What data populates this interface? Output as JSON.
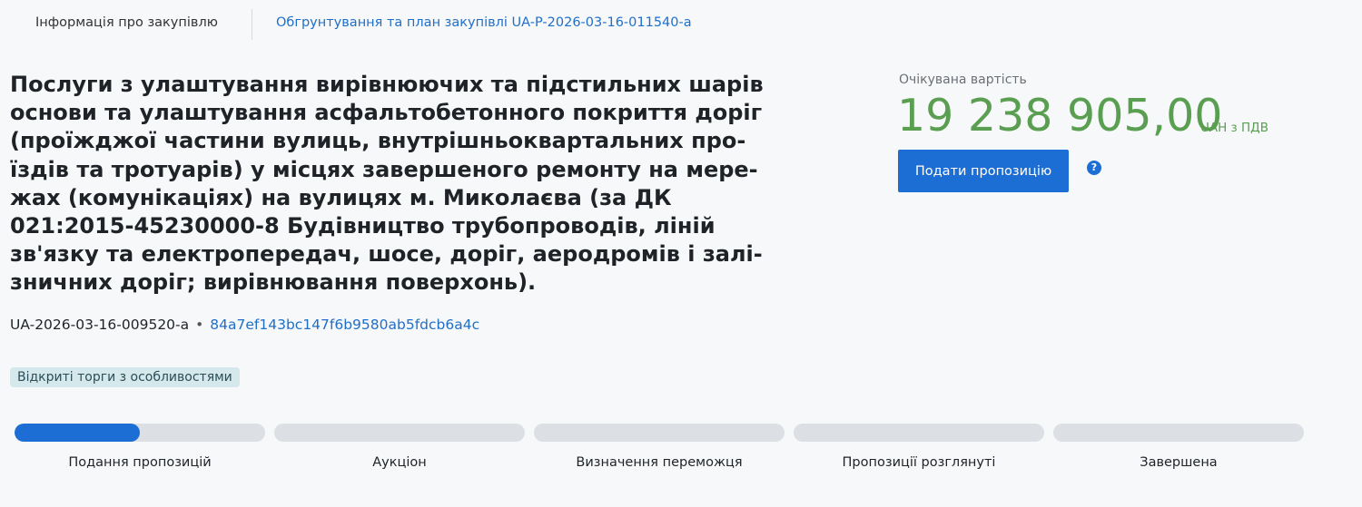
{
  "tabs": {
    "info_label": "Інформація про закупівлю",
    "plan_label": "Обгрунтування та план закупівлі UA-P-2026-03-16-011540-a"
  },
  "tender": {
    "title": "Послуги з улаштування вирівнюючих та підстильних шарів\nоснови та улаштування асфальтобетонного покриття доріг\n(проїжджої частини вулиць, внутрішньоквартальних про-\nїздів та тротуарів) у місцях завершеного ремонту на мере-\nжах (комунікаціях) на вулицях м. Миколаєва (за ДК\n021:2015-45230000-8    Будівництво трубопроводів, ліній\nзв'язку та електропередач, шосе, доріг, аеродромів і залі-\nзничних доріг; вирівнювання поверхонь).",
    "id": "UA-2026-03-16-009520-a",
    "separator": "•",
    "hash": "84a7ef143bc147f6b9580ab5fdcb6a4c",
    "procedure_badge": "Відкриті торги з особливостями"
  },
  "price": {
    "label": "Очікувана вартість",
    "amount": "19 238 905,00",
    "unit": "UAH з ПДВ",
    "color": "#5a9e51"
  },
  "actions": {
    "submit_label": "Подати пропозицію",
    "help_glyph": "?",
    "help_icon": "question-circle-icon"
  },
  "stages": [
    {
      "label": "Подання пропозицій",
      "progress": 0.5
    },
    {
      "label": "Аукціон",
      "progress": 0
    },
    {
      "label": "Визначення переможця",
      "progress": 0
    },
    {
      "label": "Пропозиції розглянуті",
      "progress": 0
    },
    {
      "label": "Завершена",
      "progress": 0
    }
  ],
  "colors": {
    "accent": "#1d6ed4",
    "link": "#1f6fc9",
    "badge_bg": "#d5e8ec",
    "track": "#dcdfe3"
  }
}
